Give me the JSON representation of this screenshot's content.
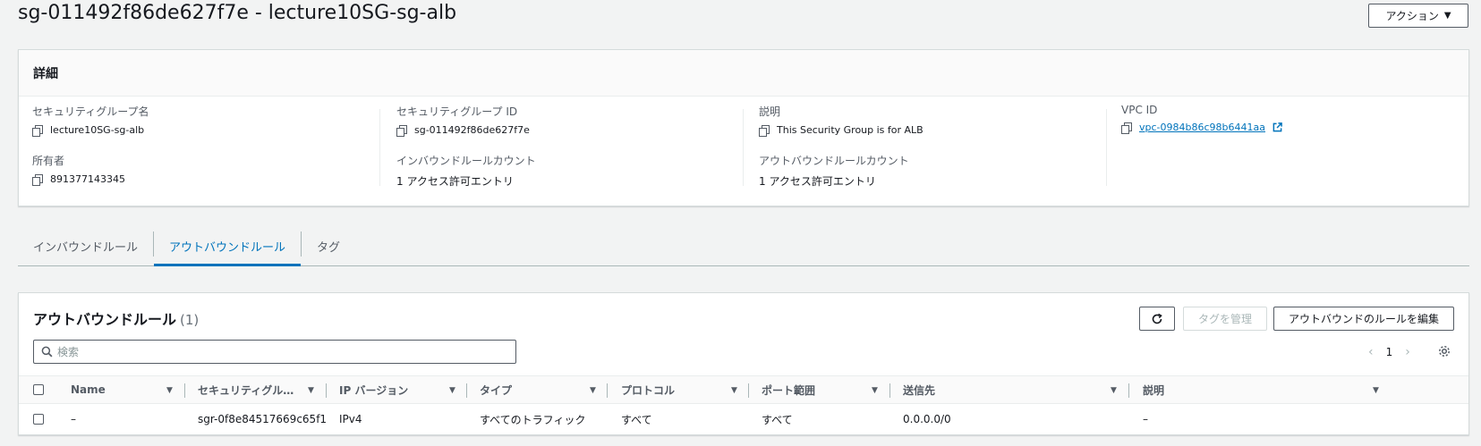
{
  "header": {
    "title": "sg-011492f86de627f7e - lecture10SG-sg-alb",
    "action_label": "アクション"
  },
  "details": {
    "heading": "詳細",
    "fields": {
      "sg_name_label": "セキュリティグループ名",
      "sg_name_value": "lecture10SG-sg-alb",
      "sg_id_label": "セキュリティグループ ID",
      "sg_id_value": "sg-011492f86de627f7e",
      "desc_label": "説明",
      "desc_value": "This Security Group is for ALB",
      "vpc_label": "VPC ID",
      "vpc_value": "vpc-0984b86c98b6441aa",
      "owner_label": "所有者",
      "owner_value": "891377143345",
      "inbound_count_label": "インバウンドルールカウント",
      "inbound_count_value": "1 アクセス許可エントリ",
      "outbound_count_label": "アウトバウンドルールカウント",
      "outbound_count_value": "1 アクセス許可エントリ"
    }
  },
  "tabs": [
    {
      "label": "インバウンドルール"
    },
    {
      "label": "アウトバウンドルール"
    },
    {
      "label": "タグ"
    }
  ],
  "rules_panel": {
    "title": "アウトバウンドルール",
    "count": "(1)",
    "manage_tags_label": "タグを管理",
    "edit_rules_label": "アウトバウンドのルールを編集",
    "search_placeholder": "検索",
    "page_number": "1",
    "columns": [
      "Name",
      "セキュリティグル…",
      "IP バージョン",
      "タイプ",
      "プロトコル",
      "ポート範囲",
      "送信先",
      "説明"
    ],
    "rows": [
      {
        "name": "–",
        "sg_rule_id": "sgr-0f8e84517669c65f1",
        "ip_version": "IPv4",
        "type": "すべてのトラフィック",
        "protocol": "すべて",
        "port_range": "すべて",
        "destination": "0.0.0.0/0",
        "description": "–"
      }
    ]
  },
  "colors": {
    "accent": "#0073bb",
    "background": "#f2f3f3",
    "border": "#d5dbdb"
  }
}
